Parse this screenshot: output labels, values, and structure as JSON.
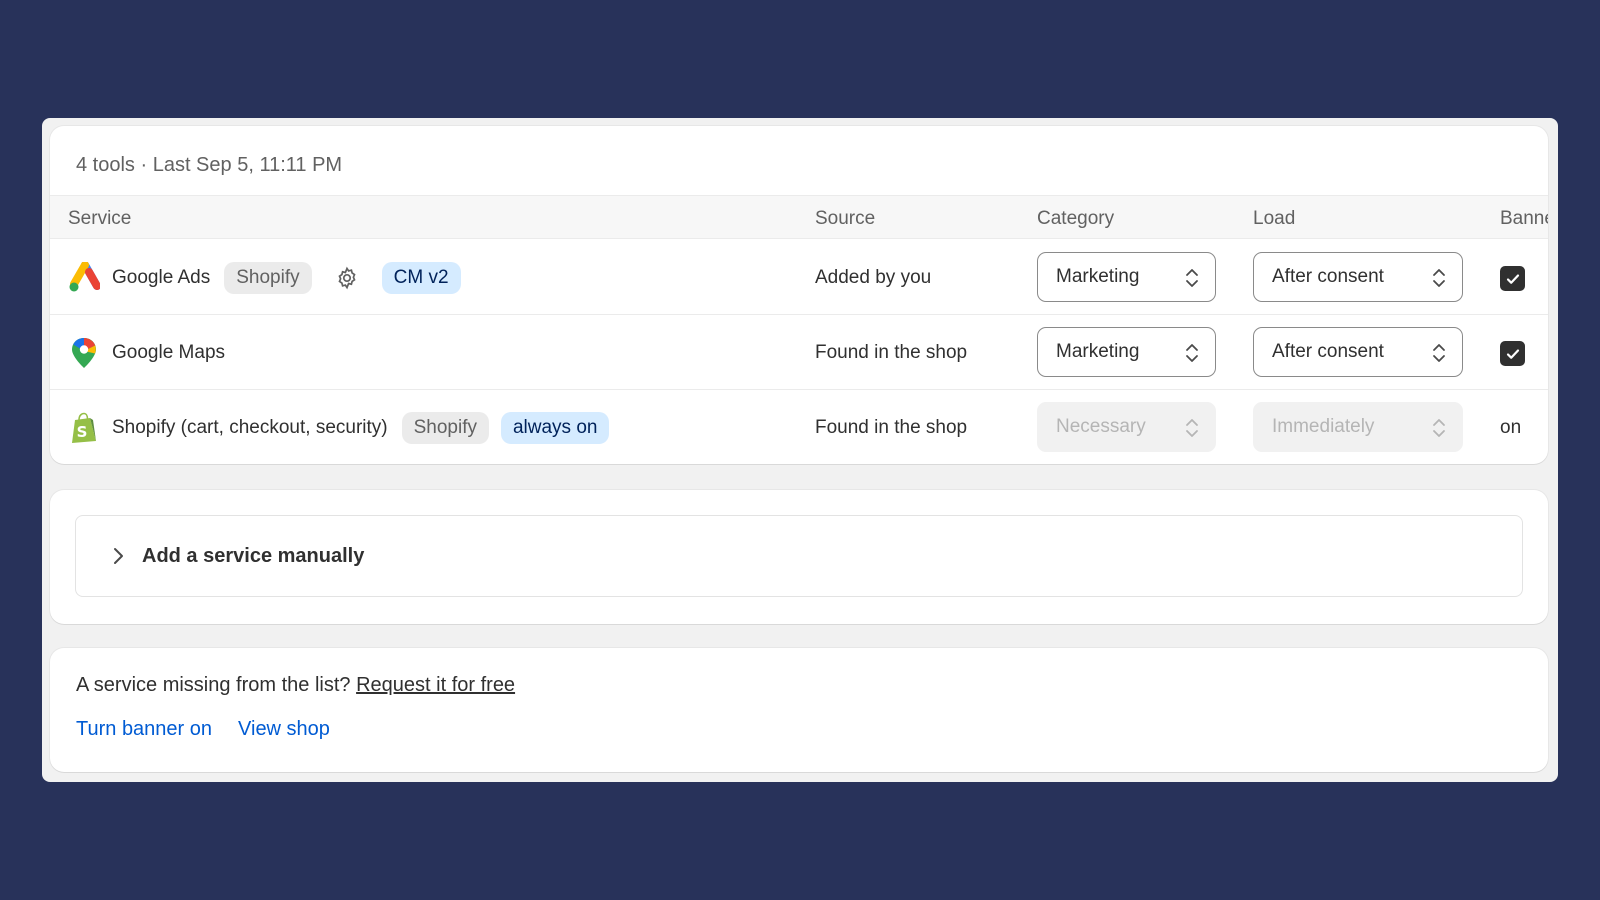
{
  "summary": "4 tools · Last Sep 5, 11:11 PM",
  "columns": {
    "service": "Service",
    "source": "Source",
    "category": "Category",
    "load": "Load",
    "banner": "Banner"
  },
  "rows": [
    {
      "name": "Google Ads",
      "icon": "google-ads-icon",
      "badges": [
        "Shopify"
      ],
      "has_settings": true,
      "tag": "CM v2",
      "source": "Added by you",
      "category": "Marketing",
      "load": "After consent",
      "banner_checked": true
    },
    {
      "name": "Google Maps",
      "icon": "google-maps-icon",
      "source": "Found in the shop",
      "category": "Marketing",
      "load": "After consent",
      "banner_checked": true
    },
    {
      "name": "Shopify (cart, checkout, security)",
      "icon": "shopify-bag-icon",
      "badges": [
        "Shopify"
      ],
      "tag": "always on",
      "source": "Found in the shop",
      "category": "Necessary",
      "load": "Immediately",
      "category_disabled": true,
      "load_disabled": true,
      "banner_text": "on"
    }
  ],
  "add_service": {
    "label": "Add a service manually"
  },
  "footer": {
    "missing_text": "A service missing from the list?",
    "request_link": "Request it for free",
    "turn_banner_on": "Turn banner on",
    "view_shop": "View shop"
  },
  "colors": {
    "background": "#28325a",
    "link": "#005bd3",
    "badge_blue": "#d5ebff"
  }
}
